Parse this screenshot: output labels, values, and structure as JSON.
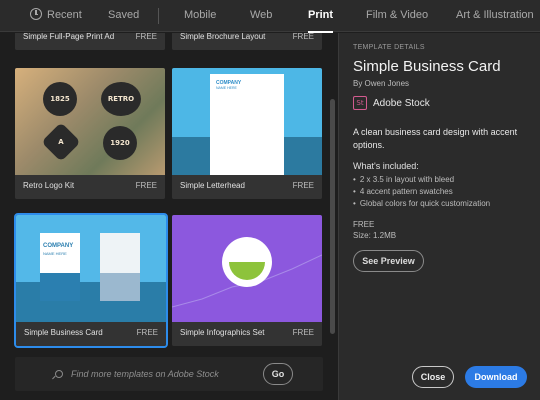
{
  "tabs": [
    {
      "label": "Recent",
      "icon": "clock-icon"
    },
    {
      "label": "Saved"
    },
    {
      "label": "Mobile"
    },
    {
      "label": "Web"
    },
    {
      "label": "Print",
      "active": true
    },
    {
      "label": "Film & Video"
    },
    {
      "label": "Art & Illustration"
    }
  ],
  "templates": [
    {
      "title": "Simple Full-Page Print Ad",
      "price": "FREE"
    },
    {
      "title": "Simple Brochure Layout",
      "price": "FREE"
    },
    {
      "title": "Retro Logo Kit",
      "price": "FREE",
      "badges": [
        "1825",
        "RETRO",
        "A",
        "1920"
      ]
    },
    {
      "title": "Simple Letterhead",
      "price": "FREE",
      "thumb_heading": "COMPANY",
      "thumb_sub": "NAME HERE"
    },
    {
      "title": "Simple Business Card",
      "price": "FREE",
      "selected": true,
      "thumb_heading": "COMPANY",
      "thumb_sub": "NAME HERE"
    },
    {
      "title": "Simple Infographics Set",
      "price": "FREE"
    }
  ],
  "search": {
    "placeholder": "Find more templates on Adobe Stock",
    "go_label": "Go"
  },
  "details": {
    "section_label": "TEMPLATE DETAILS",
    "title": "Simple Business Card",
    "author": "By Owen Jones",
    "stock_logo": "St",
    "stock_name": "Adobe Stock",
    "description": "A clean business card design with accent options.",
    "included_title": "What's included:",
    "included": [
      "2 x 3.5 in layout with bleed",
      "4 accent pattern swatches",
      "Global colors for quick customization"
    ],
    "price": "FREE",
    "size": "Size: 1.2MB",
    "preview_label": "See Preview",
    "close_label": "Close",
    "download_label": "Download"
  },
  "colors": {
    "accent": "#2c7be5",
    "stock": "#d35b8f",
    "selection": "#2d8ceb"
  }
}
